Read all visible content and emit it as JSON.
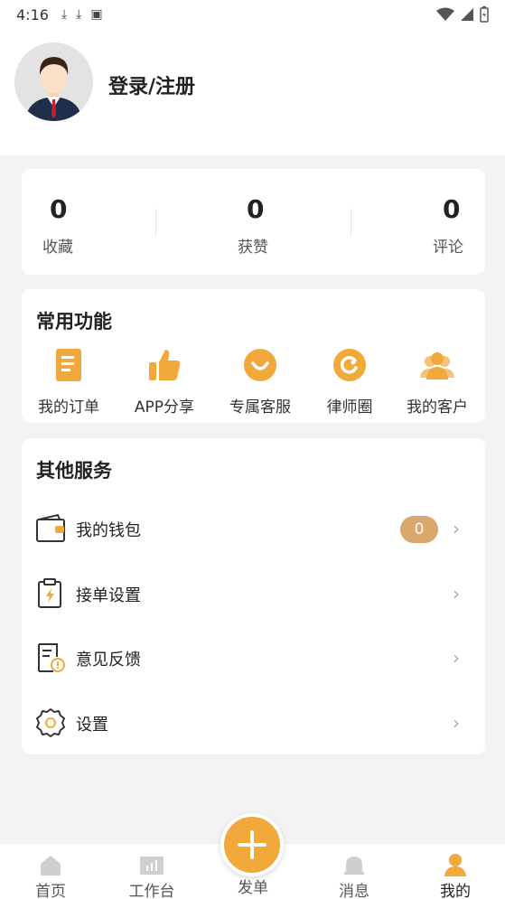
{
  "status_bar": {
    "time": "4:16"
  },
  "profile": {
    "login_label": "登录/注册"
  },
  "stats": [
    {
      "value": "0",
      "label": "收藏"
    },
    {
      "value": "0",
      "label": "获赞"
    },
    {
      "value": "0",
      "label": "评论"
    }
  ],
  "common_functions": {
    "title": "常用功能",
    "items": [
      {
        "label": "我的订单",
        "icon": "order-icon"
      },
      {
        "label": "APP分享",
        "icon": "thumbs-up-icon"
      },
      {
        "label": "专属客服",
        "icon": "customer-service-icon"
      },
      {
        "label": "律师圈",
        "icon": "lawyer-circle-icon"
      },
      {
        "label": "我的客户",
        "icon": "clients-icon"
      }
    ]
  },
  "other_services": {
    "title": "其他服务",
    "items": [
      {
        "label": "我的钱包",
        "icon": "wallet-icon",
        "badge": "0"
      },
      {
        "label": "接单设置",
        "icon": "order-settings-icon"
      },
      {
        "label": "意见反馈",
        "icon": "feedback-icon"
      },
      {
        "label": "设置",
        "icon": "gear-icon"
      }
    ]
  },
  "tabbar": {
    "items": [
      {
        "label": "首页",
        "icon": "home-icon"
      },
      {
        "label": "工作台",
        "icon": "workbench-icon"
      },
      {
        "label": "发单",
        "icon": "plus-icon"
      },
      {
        "label": "消息",
        "icon": "bell-icon"
      },
      {
        "label": "我的",
        "icon": "person-icon",
        "active": true
      }
    ]
  },
  "colors": {
    "accent": "#f0a93a",
    "badge": "#d9a86d",
    "background": "#f3f3f3"
  }
}
